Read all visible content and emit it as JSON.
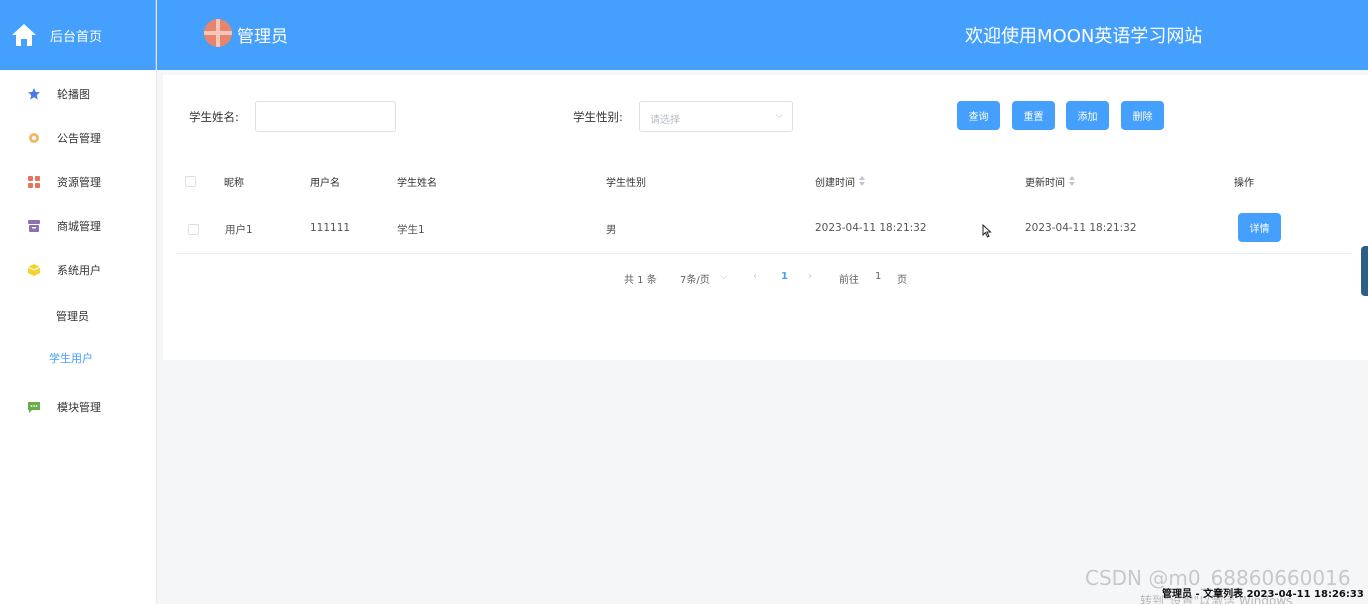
{
  "colors": {
    "primary": "#459ffc",
    "background": "#f5f6f8"
  },
  "sidebar": {
    "home_label": "后台首页",
    "items": [
      {
        "label": "轮播图",
        "icon": "star-icon"
      },
      {
        "label": "公告管理",
        "icon": "gear-icon"
      },
      {
        "label": "资源管理",
        "icon": "grid-icon"
      },
      {
        "label": "商城管理",
        "icon": "archive-icon"
      },
      {
        "label": "系统用户",
        "icon": "cube-icon"
      },
      {
        "label": "模块管理",
        "icon": "chat-icon"
      }
    ],
    "sub_items": [
      {
        "label": "管理员"
      },
      {
        "label": "学生用户"
      }
    ]
  },
  "header": {
    "username": "管理员",
    "welcome": "欢迎使用MOON英语学习网站"
  },
  "search": {
    "name_label": "学生姓名:",
    "name_value": "",
    "gender_label": "学生性别:",
    "gender_placeholder": "请选择",
    "buttons": [
      "查询",
      "重置",
      "添加",
      "删除"
    ]
  },
  "table": {
    "columns": [
      "昵称",
      "用户名",
      "学生姓名",
      "学生性别",
      "创建时间",
      "更新时间",
      "操作"
    ],
    "rows": [
      {
        "nickname": "用户1",
        "username": "111111",
        "name": "学生1",
        "gender": "男",
        "created": "2023-04-11 18:21:32",
        "updated": "2023-04-11 18:21:32",
        "action": "详情"
      }
    ]
  },
  "pagination": {
    "total": "共 1 条",
    "page_size": "7条/页",
    "current": "1",
    "goto_label": "前往",
    "goto_value": "1",
    "goto_unit": "页"
  },
  "overlay": {
    "watermark": "CSDN @m0_68860660016",
    "windows_activate": "转到\"设置\"以激活 Windows",
    "status": "管理员 - 文章列表 2023-04-11 18:26:33"
  }
}
